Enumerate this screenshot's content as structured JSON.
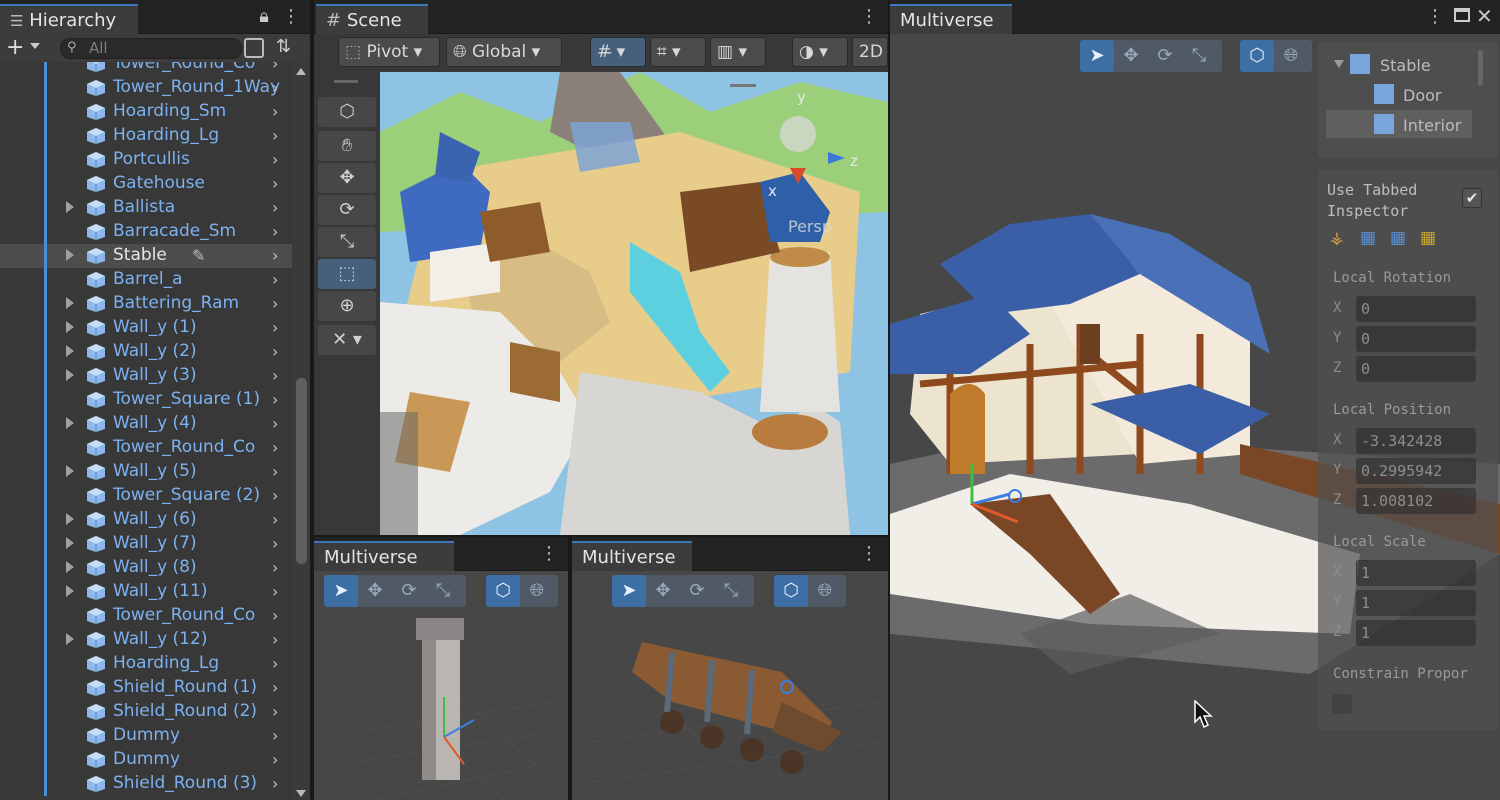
{
  "hierarchy": {
    "tab": "Hierarchy",
    "search_placeholder": "All",
    "items": [
      {
        "label": "Tower_Round_Co",
        "fold": false
      },
      {
        "label": "Tower_Round_1Way",
        "fold": false
      },
      {
        "label": "Hoarding_Sm",
        "fold": false
      },
      {
        "label": "Hoarding_Lg",
        "fold": false
      },
      {
        "label": "Portcullis",
        "fold": false
      },
      {
        "label": "Gatehouse",
        "fold": false
      },
      {
        "label": "Ballista",
        "fold": true
      },
      {
        "label": "Barracade_Sm",
        "fold": false
      },
      {
        "label": "Stable",
        "fold": true,
        "selected": true
      },
      {
        "label": "Barrel_a",
        "fold": false
      },
      {
        "label": "Battering_Ram",
        "fold": true
      },
      {
        "label": "Wall_y (1)",
        "fold": true
      },
      {
        "label": "Wall_y (2)",
        "fold": true
      },
      {
        "label": "Wall_y (3)",
        "fold": true
      },
      {
        "label": "Tower_Square (1)",
        "fold": false
      },
      {
        "label": "Wall_y (4)",
        "fold": true
      },
      {
        "label": "Tower_Round_Co",
        "fold": false
      },
      {
        "label": "Wall_y (5)",
        "fold": true
      },
      {
        "label": "Tower_Square (2)",
        "fold": false
      },
      {
        "label": "Wall_y (6)",
        "fold": true
      },
      {
        "label": "Wall_y (7)",
        "fold": true
      },
      {
        "label": "Wall_y (8)",
        "fold": true
      },
      {
        "label": "Wall_y (11)",
        "fold": true
      },
      {
        "label": "Tower_Round_Co",
        "fold": false
      },
      {
        "label": "Wall_y (12)",
        "fold": true
      },
      {
        "label": "Hoarding_Lg",
        "fold": false
      },
      {
        "label": "Shield_Round (1)",
        "fold": false
      },
      {
        "label": "Shield_Round (2)",
        "fold": false
      },
      {
        "label": "Dummy",
        "fold": false
      },
      {
        "label": "Dummy",
        "fold": false
      },
      {
        "label": "Shield_Round (3)",
        "fold": false
      }
    ]
  },
  "scene": {
    "tab": "Scene",
    "pivot": "Pivot",
    "global": "Global",
    "mode_2d": "2D",
    "gizmo_y": "y",
    "gizmo_x": "x",
    "gizmo_z": "z",
    "persp": "Persp"
  },
  "multiverse_left": {
    "tab": "Multiverse"
  },
  "multiverse_mid": {
    "tab": "Multiverse"
  },
  "multiverse_main": {
    "tab": "Multiverse",
    "tree": [
      "Stable",
      "Door",
      "Interior"
    ],
    "use_tabbed": "Use Tabbed Inspector",
    "local_rotation": "Local Rotation",
    "rot": {
      "x": "0",
      "y": "0",
      "z": "0"
    },
    "local_position": "Local Position",
    "pos": {
      "x": "-3.342428",
      "y": "0.2995942",
      "z": "1.008102"
    },
    "local_scale": "Local Scale",
    "scale": {
      "x": "1",
      "y": "1",
      "z": "1"
    },
    "constrain": "Constrain Propor",
    "axis_x": "X",
    "axis_y": "Y",
    "axis_z": "Z"
  },
  "colors": {
    "accent": "#3a79bb",
    "link": "#7cb2f0",
    "panel": "#383838"
  }
}
